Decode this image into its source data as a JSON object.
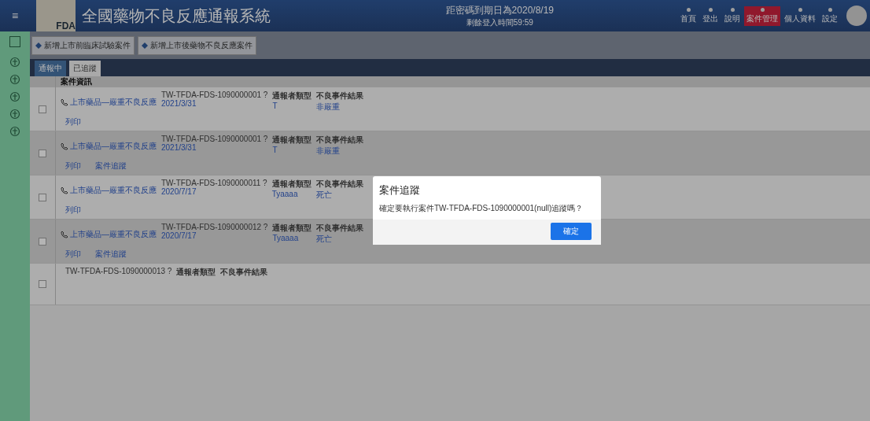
{
  "header": {
    "menu_icon": "≡",
    "logo_text": "FDA",
    "title": "全國藥物不良反應通報系統",
    "notice": "距密碼到期日為2020/8/19",
    "notice_sub": "剩餘登入時間59:59",
    "nav": [
      {
        "label": "首頁",
        "selected": false
      },
      {
        "label": "登出",
        "selected": false
      },
      {
        "label": "說明",
        "selected": false
      },
      {
        "label": "案件管理",
        "selected": true
      },
      {
        "label": "個人資料",
        "selected": false
      },
      {
        "label": "設定",
        "selected": false
      }
    ]
  },
  "toolbar": {
    "buttons": [
      "新增上市前臨床試驗案件",
      "新增上市後藥物不良反應案件"
    ]
  },
  "tabs": [
    {
      "label": "通報中",
      "selected": false
    },
    {
      "label": "已追蹤",
      "selected": true
    }
  ],
  "table": {
    "column": "案件資訊",
    "rows": [
      {
        "checked": false,
        "type": "上市藥品—嚴重不良反應",
        "date": "2021/3/31",
        "case_id": "TW-TFDA-FDS-1090000001 ?",
        "reporter_label": "通報者類型",
        "reporter": "T",
        "result_label": "不良事件結果",
        "result": "非嚴重",
        "actions": [
          "列印"
        ]
      },
      {
        "checked": false,
        "type": "上市藥品—嚴重不良反應",
        "date": "2021/3/31",
        "case_id": "TW-TFDA-FDS-1090000001 ?",
        "reporter_label": "通報者類型",
        "reporter": "T",
        "result_label": "不良事件結果",
        "result": "非嚴重",
        "actions": [
          "列印",
          "案件追蹤"
        ]
      },
      {
        "checked": false,
        "type": "上市藥品—嚴重不良反應",
        "date": "2020/7/17",
        "case_id": "TW-TFDA-FDS-1090000011 ?",
        "reporter_label": "通報者類型",
        "reporter": "Tyaaaa",
        "result_label": "不良事件結果",
        "result": "死亡",
        "actions": [
          "列印"
        ]
      },
      {
        "checked": false,
        "type": "上市藥品—嚴重不良反應",
        "date": "2020/7/17",
        "case_id": "TW-TFDA-FDS-1090000012 ?",
        "reporter_label": "通報者類型",
        "reporter": "Tyaaaa",
        "result_label": "不良事件結果",
        "result": "死亡",
        "actions": [
          "列印",
          "案件追蹤"
        ]
      },
      {
        "checked": false,
        "case_id": "TW-TFDA-FDS-1090000013 ?",
        "reporter_label": "通報者類型",
        "result_label": "不良事件結果",
        "actions": []
      }
    ]
  },
  "dialog": {
    "title": "案件追蹤",
    "message": "確定要執行案件TW-TFDA-FDS-1090000001(null)追蹤嗎？",
    "button": "確定"
  }
}
